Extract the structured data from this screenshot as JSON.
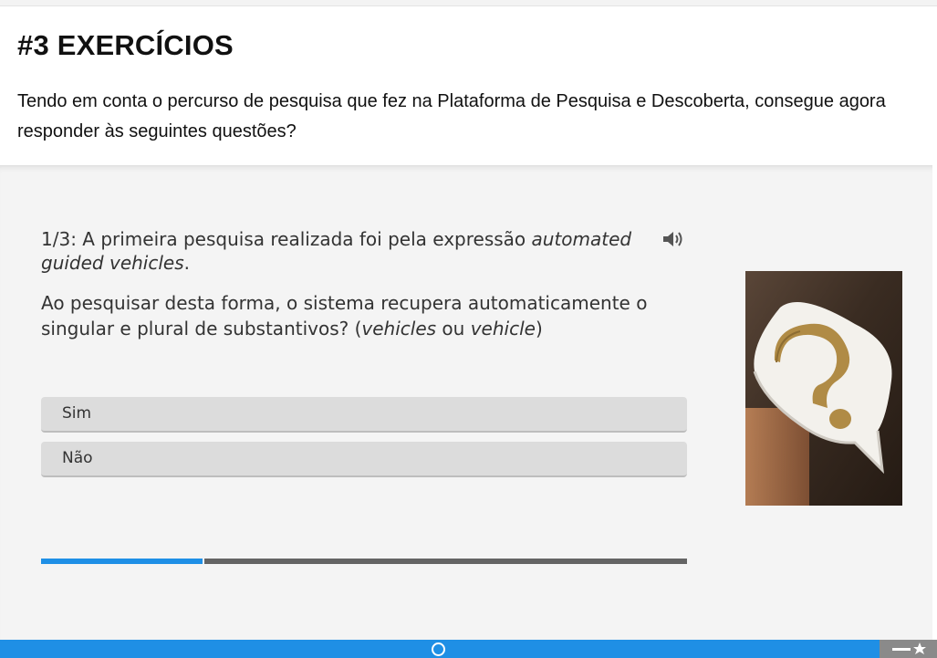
{
  "header": {
    "title": "#3 EXERCÍCIOS",
    "intro": "Tendo em conta o percurso de pesquisa que fez na Plataforma de Pesquisa e Descoberta, consegue agora responder às seguintes questões?"
  },
  "question": {
    "counter": "1/3:",
    "lead": "A primeira pesquisa realizada foi pela expressão",
    "term": "automated guided vehicles",
    "term_end": ".",
    "body_part1": "Ao pesquisar desta forma, o sistema recupera automaticamente o singular e plural de substantivos? (",
    "plural": "vehicles",
    "connector": " ou ",
    "singular": "vehicle",
    "body_close": ")",
    "audio_icon": "speaker-icon"
  },
  "options": [
    {
      "label": "Sim"
    },
    {
      "label": "Não"
    }
  ],
  "progress": {
    "current": 1,
    "total": 3,
    "fraction": 0.25
  },
  "image": {
    "icon": "question-mark-speech-bubble-icon"
  },
  "footer": {
    "nav_icon": "circle-nav-icon",
    "corner_icon": "star-menu-icon"
  },
  "colors": {
    "accent": "#1f8fe5",
    "progress_track": "#646464",
    "panel_bg": "#f4f4f4",
    "option_bg": "#dcdcdc"
  }
}
